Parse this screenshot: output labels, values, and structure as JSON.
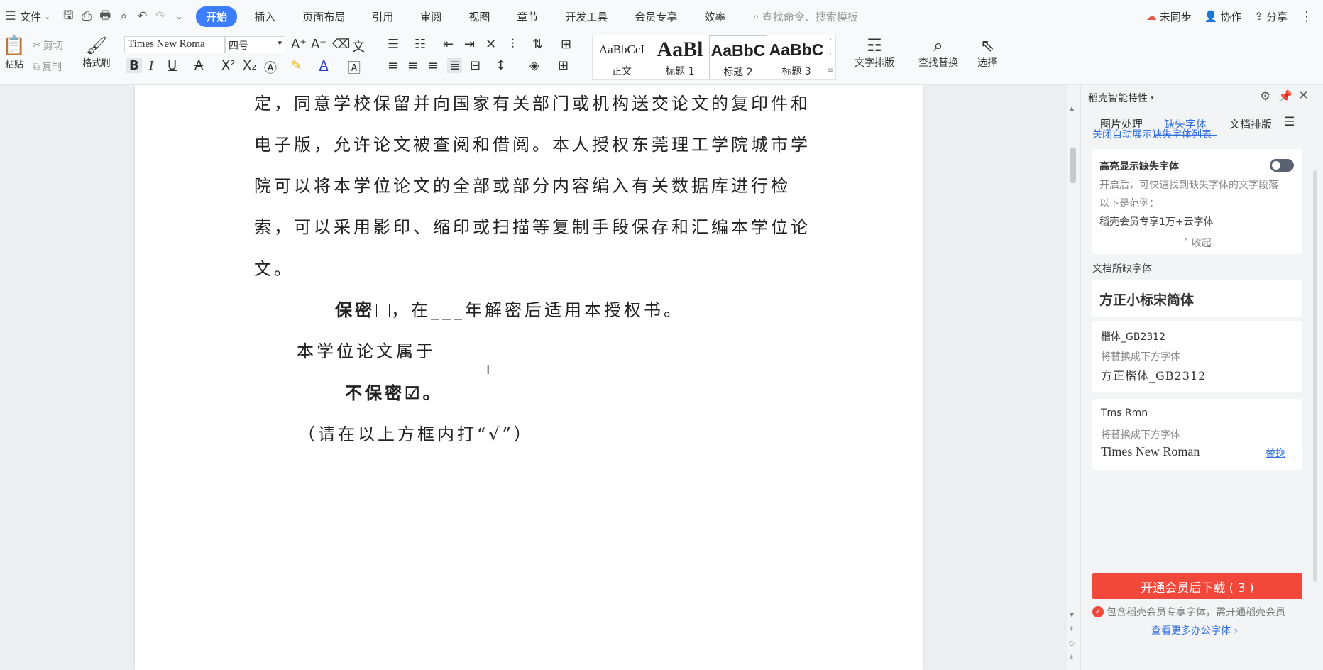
{
  "menubar": {
    "file_label": "文件",
    "tabs": [
      "开始",
      "插入",
      "页面布局",
      "引用",
      "审阅",
      "视图",
      "章节",
      "开发工具",
      "会员专享",
      "效率"
    ],
    "active_tab": "开始",
    "search_placeholder": "查找命令、搜索模板",
    "sync_label": "未同步",
    "collab_label": "协作",
    "share_label": "分享"
  },
  "ribbon": {
    "paste": "粘贴",
    "cut": "剪切",
    "copy": "复制",
    "format_painter": "格式刷",
    "font_name": "Times New Roma",
    "font_size": "四号",
    "styles": [
      {
        "sample": "AaBbCcI",
        "label": "正文"
      },
      {
        "sample": "AaBl",
        "label": "标题 1"
      },
      {
        "sample": "AaBbC",
        "label": "标题 2"
      },
      {
        "sample": "AaBbC",
        "label": "标题 3"
      }
    ],
    "text_layout": "文字排版",
    "find_replace": "查找替换",
    "select": "选择"
  },
  "document": {
    "lines": [
      "定，同意学校保留并向国家有关部门或机构送交论文的复印件和",
      "电子版，允许论文被查阅和借阅。本人授权东莞理工学院城市学",
      "院可以将本学位论文的全部或部分内容编入有关数据库进行检",
      "索，可以采用影印、缩印或扫描等复制手段保存和汇编本学位论",
      "文。"
    ],
    "secret_line_bold": "保密",
    "secret_line_rest": "，在___年解密后适用本授权书。",
    "belongs_line": "本学位论文属于",
    "not_secret_line": "不保密☑。",
    "instruction_line": "（请在以上方框内打“√”）"
  },
  "panel": {
    "title": "稻壳智能特性",
    "tabs": [
      "图片处理",
      "缺失字体",
      "文档排版"
    ],
    "active_tab": "缺失字体",
    "close_auto_link": "关闭自动展示缺失字体列表",
    "highlight_title": "高亮显示缺失字体",
    "highlight_desc": "开启后，可快速找到缺失字体的文字段落",
    "example_label": "以下是范例：",
    "example_text": "稻壳会员专享1万+云字体",
    "collapse_label": "收起",
    "missing_fonts_label": "文档所缺字体",
    "missing_fonts": [
      {
        "name": "方正小标宋简体"
      },
      {
        "name": "楷体_GB2312",
        "replace_hint": "将替换成下方字体",
        "replacement": "方正楷体_GB2312"
      },
      {
        "name": "Tms Rmn",
        "replace_hint": "将替换成下方字体",
        "replacement": "Times New Roman",
        "action": "替换"
      }
    ],
    "download_button": "开通会员后下载 ( 3 )",
    "member_note": "包含稻壳会员专享字体，需开通稻壳会员",
    "more_fonts_link": "查看更多办公字体 ›"
  },
  "colors": {
    "accent": "#3d7eff",
    "link": "#2f6ee0",
    "download": "#f2483c"
  }
}
